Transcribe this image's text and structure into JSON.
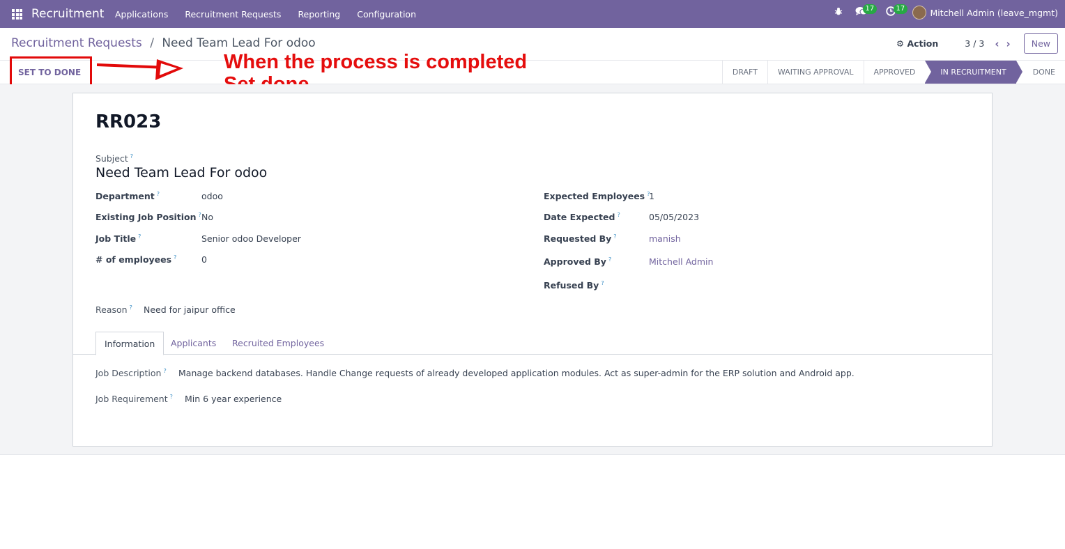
{
  "topbar": {
    "app_name": "Recruitment",
    "menu": [
      "Applications",
      "Recruitment Requests",
      "Reporting",
      "Configuration"
    ],
    "messages_count": "17",
    "activities_count": "17",
    "user": "Mitchell Admin (leave_mgmt)",
    "icons": [
      "apps-grid-icon",
      "bug-icon",
      "chat-icon",
      "clock-icon"
    ]
  },
  "control_panel": {
    "breadcrumb_parent": "Recruitment Requests",
    "breadcrumb_sep": "/",
    "breadcrumb_current": "Need Team Lead For odoo",
    "action_label": "Action",
    "pager": "3 / 3",
    "new_label": "New"
  },
  "statusbar": {
    "button": "SET TO DONE",
    "stages": [
      "DRAFT",
      "WAITING APPROVAL",
      "APPROVED",
      "IN RECRUITMENT",
      "DONE"
    ],
    "active_stage": "IN RECRUITMENT"
  },
  "annotation": {
    "line1": "When the process is completed",
    "line2": "Set done",
    "color": "#e50d0d"
  },
  "record": {
    "name": "RR023",
    "subject_label": "Subject",
    "subject": "Need Team Lead For odoo",
    "left": [
      {
        "label": "Department",
        "value": "odoo"
      },
      {
        "label": "Existing Job Position",
        "value": "No"
      },
      {
        "label": "Job Title",
        "value": "Senior odoo Developer"
      },
      {
        "label": "# of employees",
        "value": "0"
      }
    ],
    "right": [
      {
        "label": "Expected Employees",
        "value": "1"
      },
      {
        "label": "Date Expected",
        "value": "05/05/2023"
      },
      {
        "label": "Requested By",
        "value": "manish"
      },
      {
        "label": "Approved By",
        "value": "Mitchell Admin"
      },
      {
        "label": "Refused By",
        "value": ""
      }
    ],
    "reason_label": "Reason",
    "reason": "Need for jaipur office",
    "tabs": [
      "Information",
      "Applicants",
      "Recruited Employees"
    ],
    "job_description_label": "Job Description",
    "job_description": "Manage backend databases. Handle Change requests of already developed application modules. Act as super-admin for the ERP solution and Android app.",
    "job_requirement_label": "Job Requirement",
    "job_requirement": "Min 6 year experience"
  },
  "colors": {
    "brand": "#71639e",
    "badge": "#27a844",
    "annotation": "#e20a0a"
  }
}
